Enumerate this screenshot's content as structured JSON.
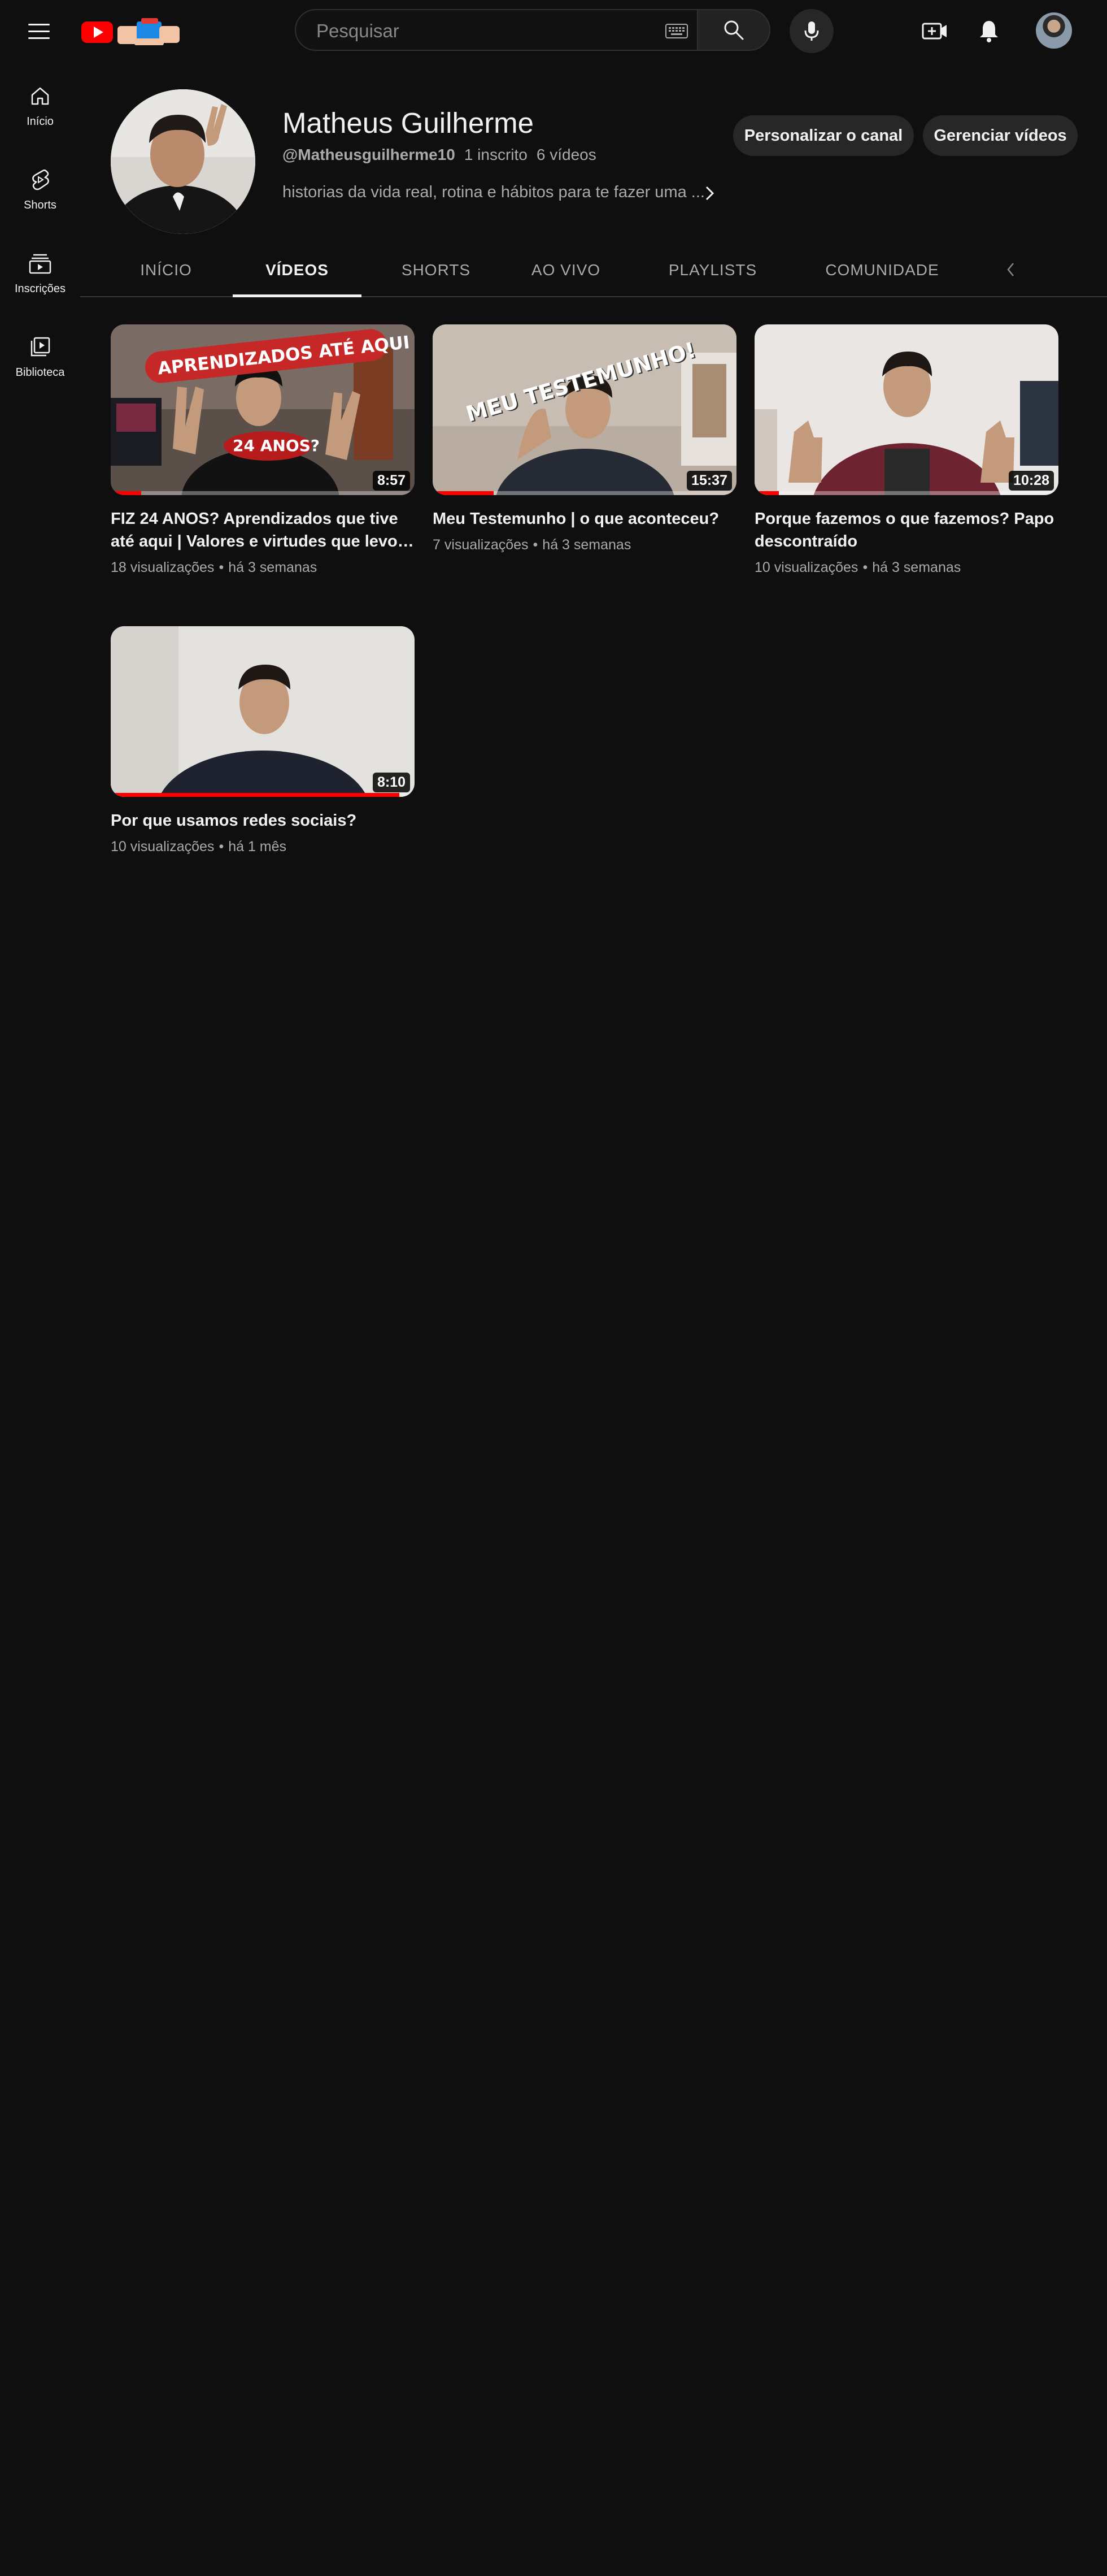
{
  "header": {
    "search_placeholder": "Pesquisar",
    "icons": [
      "menu-icon",
      "youtube-logo",
      "keyboard-icon",
      "search-icon",
      "mic-icon",
      "create-video-icon",
      "bell-icon",
      "avatar"
    ]
  },
  "sidebar": {
    "items": [
      {
        "label": "Início",
        "icon": "home-icon"
      },
      {
        "label": "Shorts",
        "icon": "shorts-icon"
      },
      {
        "label": "Inscrições",
        "icon": "subscriptions-icon"
      },
      {
        "label": "Biblioteca",
        "icon": "library-icon"
      }
    ]
  },
  "channel": {
    "name": "Matheus Guilherme",
    "handle": "@Matheusguilherme10",
    "subscribers": "1 inscrito",
    "videos_count": "6 vídeos",
    "description": "historias da vida real, rotina e hábitos para te fazer uma ...",
    "customize_label": "Personalizar o canal",
    "manage_label": "Gerenciar vídeos"
  },
  "tabs": [
    {
      "label": "INÍCIO",
      "active": false
    },
    {
      "label": "VÍDEOS",
      "active": true
    },
    {
      "label": "SHORTS",
      "active": false
    },
    {
      "label": "AO VIVO",
      "active": false
    },
    {
      "label": "PLAYLISTS",
      "active": false
    },
    {
      "label": "COMUNIDADE",
      "active": false
    }
  ],
  "videos": [
    {
      "title": "FIZ 24 ANOS? Aprendizados que tive até aqui | Valores e virtudes que levo…",
      "duration": "8:57",
      "views": "18 visualizações",
      "age": "há 3 semanas",
      "thumb_text_1": "APRENDIZADOS ATÉ AQUI !",
      "thumb_text_2": "24 ANOS?",
      "watched_fraction": 0.1
    },
    {
      "title": "Meu Testemunho | o que aconteceu?",
      "duration": "15:37",
      "views": "7 visualizações",
      "age": "há 3 semanas",
      "thumb_text_1": "MEU TESTEMUNHO!",
      "watched_fraction": 0.2
    },
    {
      "title": "Porque fazemos o que fazemos? Papo descontraído",
      "duration": "10:28",
      "views": "10 visualizações",
      "age": "há 3 semanas",
      "watched_fraction": 0.08
    },
    {
      "title": "Por que usamos redes sociais?",
      "duration": "8:10",
      "views": "10 visualizações",
      "age": "há 1 mês",
      "watched_fraction": 0.95
    }
  ],
  "colors": {
    "background": "#0f0f0f",
    "accent_red": "#ff0000",
    "button_bg": "#272727",
    "text_secondary": "#aaaaaa"
  }
}
